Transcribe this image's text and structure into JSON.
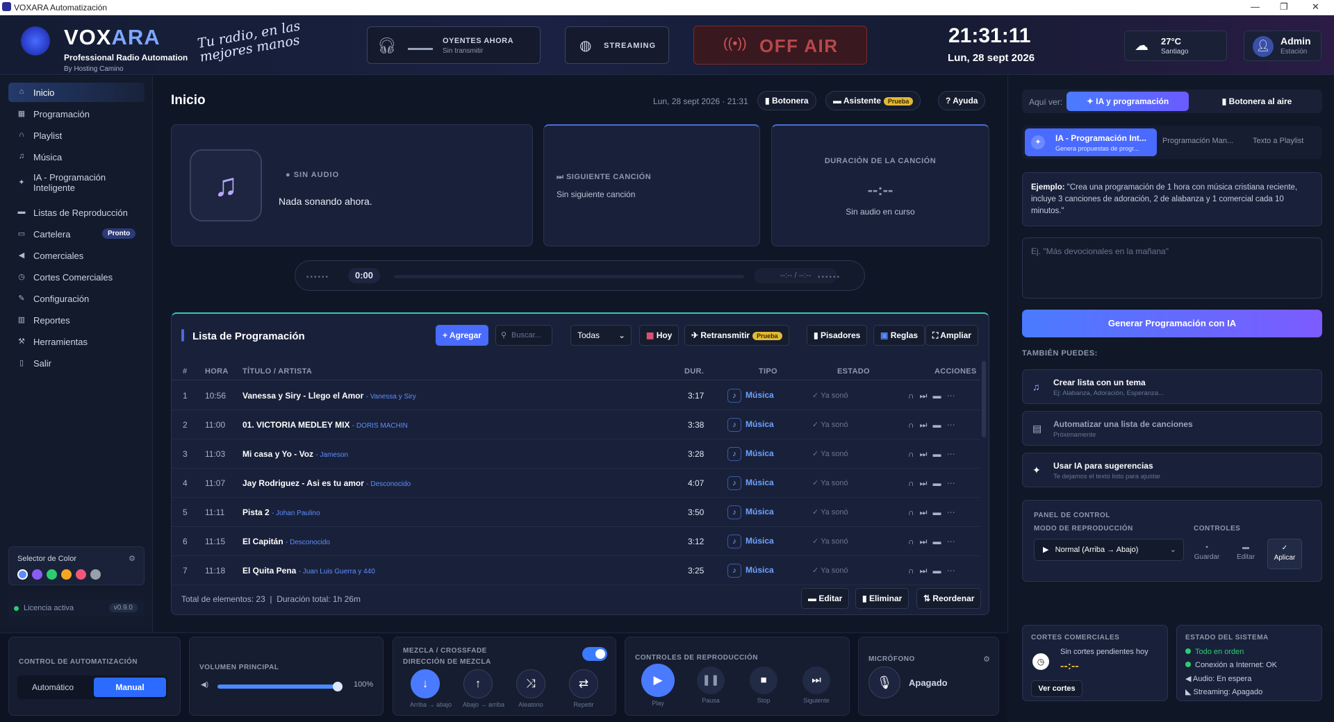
{
  "window": {
    "title": "VOXARA Automatización"
  },
  "header": {
    "brand_main": "VOX",
    "brand_accent": "ARA",
    "brand_sub": "Professional Radio Automation",
    "brand_by": "By Hosting Camino",
    "slogan": "Tu radio, en las mejores manos",
    "listeners_title": "OYENTES AHORA",
    "listeners_sub": "Sin transmitir",
    "streaming": "STREAMING",
    "offair": "OFF AIR",
    "time": "21:31:11",
    "date": "Lun, 28 sept 2026",
    "weather_temp": "27°C",
    "weather_city": "Santiago",
    "user_name": "Admin",
    "user_role": "Estación"
  },
  "sidebar": {
    "items": [
      {
        "label": "Inicio",
        "icon": "home-icon"
      },
      {
        "label": "Programación",
        "icon": "calendar-icon"
      },
      {
        "label": "Playlist",
        "icon": "headphones-icon"
      },
      {
        "label": "Música",
        "icon": "music-note-icon"
      },
      {
        "label": "IA - Programación Inteligente",
        "icon": "sparkle-icon"
      },
      {
        "label": "Listas de Reproducción",
        "icon": "folder-icon"
      },
      {
        "label": "Cartelera",
        "icon": "billboard-icon",
        "badge": "Pronto"
      },
      {
        "label": "Comerciales",
        "icon": "megaphone-icon"
      },
      {
        "label": "Cortes Comerciales",
        "icon": "clock-icon"
      },
      {
        "label": "Configuración",
        "icon": "pencil-icon"
      },
      {
        "label": "Reportes",
        "icon": "chart-icon"
      },
      {
        "label": "Herramientas",
        "icon": "wrench-icon"
      },
      {
        "label": "Salir",
        "icon": "door-icon"
      }
    ],
    "color_label": "Selector de Color",
    "colors": [
      "#5a8cff",
      "#8a5cf6",
      "#2ecc71",
      "#f5a623",
      "#f0567a",
      "#9aa0aa"
    ],
    "license": "Licencia activa",
    "version": "v0.9.0"
  },
  "main": {
    "title": "Inicio",
    "datetime": "Lun, 28 sept 2026 · 21:31",
    "btn_botonera": "Botonera",
    "btn_asistente": "Asistente",
    "tag_prueba": "Prueba",
    "btn_ayuda": "Ayuda",
    "now_status": "SIN AUDIO",
    "now_text": "Nada sonando ahora.",
    "next_title": "SIGUIENTE CANCIÓN",
    "next_text": "Sin siguiente canción",
    "dur_title": "DURACIÓN DE LA CANCIÓN",
    "dur_value": "--:--",
    "dur_text": "Sin audio en curso",
    "pos": "0:00",
    "remain": "--:-- / --:--"
  },
  "playlist": {
    "title": "Lista de Programación",
    "add": "+ Agregar",
    "search_placeholder": "Buscar...",
    "filter": "Todas",
    "today": "Hoy",
    "retrans": "Retransmitir",
    "tag": "Prueba",
    "pisadores": "Pisadores",
    "reglas": "Reglas",
    "ampliar": "Ampliar",
    "columns": [
      "#",
      "HORA",
      "TÍTULO / ARTISTA",
      "DUR.",
      "TIPO",
      "ESTADO",
      "ACCIONES"
    ],
    "rows": [
      {
        "n": "1",
        "h": "10:56",
        "t": "Vanessa y Siry - Llego el Amor",
        "a": "Vanessa y Siry",
        "d": "3:17",
        "ty": "Música",
        "s": "✓ Ya sonó"
      },
      {
        "n": "2",
        "h": "11:00",
        "t": "01. VICTORIA MEDLEY MIX",
        "a": "DORIS MACHIN",
        "d": "3:38",
        "ty": "Música",
        "s": "✓ Ya sonó"
      },
      {
        "n": "3",
        "h": "11:03",
        "t": "Mi casa y Yo - Voz",
        "a": "Jameson",
        "d": "3:28",
        "ty": "Música",
        "s": "✓ Ya sonó"
      },
      {
        "n": "4",
        "h": "11:07",
        "t": "Jay Rodriguez - Asi es tu amor",
        "a": "Desconocido",
        "d": "4:07",
        "ty": "Música",
        "s": "✓ Ya sonó"
      },
      {
        "n": "5",
        "h": "11:11",
        "t": "Pista 2",
        "a": "Johan Paulino",
        "d": "3:50",
        "ty": "Música",
        "s": "✓ Ya sonó"
      },
      {
        "n": "6",
        "h": "11:15",
        "t": "El Capitán",
        "a": "Desconocido",
        "d": "3:12",
        "ty": "Música",
        "s": "✓ Ya sonó"
      },
      {
        "n": "7",
        "h": "11:18",
        "t": "El Quita Pena",
        "a": "Juan Luis Guerra y 440",
        "d": "3:25",
        "ty": "Música",
        "s": "✓ Ya sonó"
      }
    ],
    "total": "Total de elementos: 23",
    "duration": "Duración total: 1h 26m",
    "edit": "Editar",
    "delete": "Eliminar",
    "reorder": "Reordenar"
  },
  "right": {
    "ver_label": "Aquí ver:",
    "seg_ia": "IA y programación",
    "seg_bot": "Botonera al aire",
    "tab1": "IA - Programación Int...",
    "tab1_sub": "Genera propuestas de progr...",
    "tab2": "Programación Man...",
    "tab3": "Texto a Playlist",
    "example_bold": "Ejemplo:",
    "example_text": " \"Crea una programación de 1 hora con música cristiana reciente, incluye 3 canciones de adoración, 2 de alabanza y 1 comercial cada 10 minutos.\"",
    "textarea_placeholder": "Ej. \"Más devocionales en la mañana\"",
    "generate": "Generar Programación con IA",
    "tambien": "TAMBIÉN PUEDES:",
    "opts": [
      {
        "t": "Crear lista con un tema",
        "s": "Ej: Alabanza, Adoración, Esperanza..."
      },
      {
        "t": "Automatizar una lista de canciones",
        "s": "Próximamente"
      },
      {
        "t": "Usar IA para sugerencias",
        "s": "Te dejamos el texto listo para ajustar"
      }
    ],
    "panel_title": "PANEL DE CONTROL",
    "modo": "MODO DE REPRODUCCIÓN",
    "controles": "CONTROLES",
    "mode_value": "Normal (Arriba → Abajo)",
    "guardar": "Guardar",
    "editar": "Editar",
    "aplicar": "Aplicar",
    "cortes_title": "CORTES COMERCIALES",
    "cortes_text": "Sin cortes pendientes hoy",
    "cortes_time": "--:--",
    "ver_cortes": "Ver cortes",
    "estado_title": "ESTADO DEL SISTEMA",
    "estado": [
      "Todo en orden",
      "Conexión a Internet: OK",
      "Audio: En espera",
      "Streaming: Apagado"
    ]
  },
  "bottom": {
    "auto_title": "CONTROL DE AUTOMATIZACIÓN",
    "auto": "Automático",
    "manual": "Manual",
    "vol_title": "VOLUMEN PRINCIPAL",
    "volume": 1.0,
    "vol_pct": "100%",
    "mix_title": "MEZCLA / CROSSFADE",
    "mix_dir": "DIRECCIÓN DE MEZCLA",
    "mix": [
      "Arriba → abajo",
      "Abajo → arriba",
      "Aleatorio",
      "Repetir"
    ],
    "play_title": "CONTROLES DE REPRODUCCIÓN",
    "play": [
      "Play",
      "Pausa",
      "Stop",
      "Siguiente"
    ],
    "mic_title": "MICRÓFONO",
    "mic_state": "Apagado"
  }
}
